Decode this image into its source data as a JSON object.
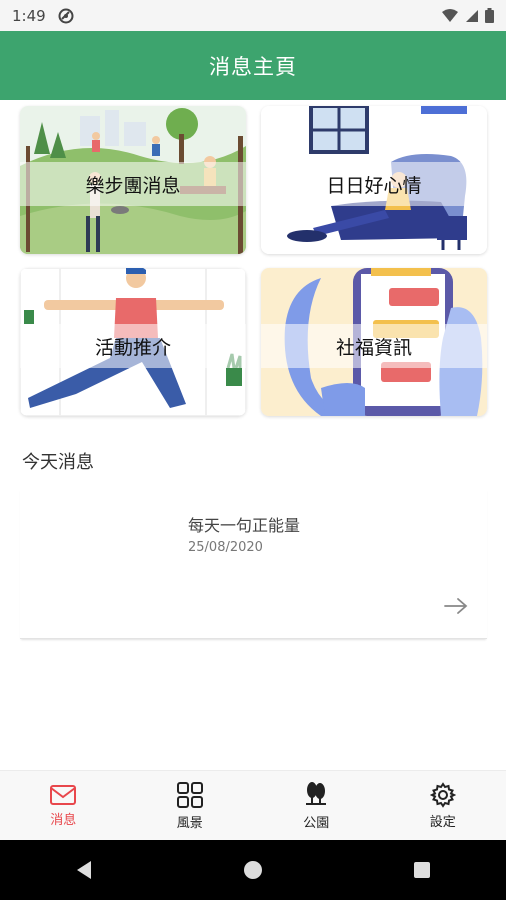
{
  "status_bar": {
    "time": "1:49"
  },
  "app_bar": {
    "title": "消息主頁"
  },
  "tiles": [
    {
      "label": "樂步團消息"
    },
    {
      "label": "日日好心情"
    },
    {
      "label": "活動推介"
    },
    {
      "label": "社福資訊"
    }
  ],
  "today": {
    "section_title": "今天消息",
    "message": {
      "title": "每天一句正能量",
      "date": "25/08/2020"
    }
  },
  "bottom_nav": [
    {
      "label": "消息",
      "icon": "mail-icon",
      "active": true
    },
    {
      "label": "風景",
      "icon": "grid-icon",
      "active": false
    },
    {
      "label": "公園",
      "icon": "park-icon",
      "active": false
    },
    {
      "label": "設定",
      "icon": "gear-icon",
      "active": false
    }
  ],
  "colors": {
    "primary": "#3da46e",
    "active_nav": "#e8474c"
  }
}
